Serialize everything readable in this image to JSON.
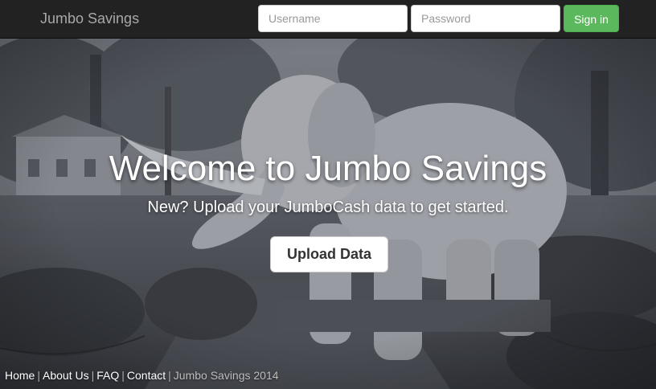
{
  "navbar": {
    "brand": "Jumbo Savings",
    "username_placeholder": "Username",
    "password_placeholder": "Password",
    "signin_label": "Sign in",
    "signin_color": "#5cb85c",
    "background_color": "#222222"
  },
  "hero": {
    "title": "Welcome to Jumbo Savings",
    "subtitle": "New? Upload your JumboCash data to get started.",
    "upload_label": "Upload Data",
    "background_image": "grayscale photo of elephant statue in a park"
  },
  "footer": {
    "links": [
      "Home",
      "About Us",
      "FAQ",
      "Contact"
    ],
    "separator": "|",
    "copyright": "Jumbo Savings 2014"
  }
}
